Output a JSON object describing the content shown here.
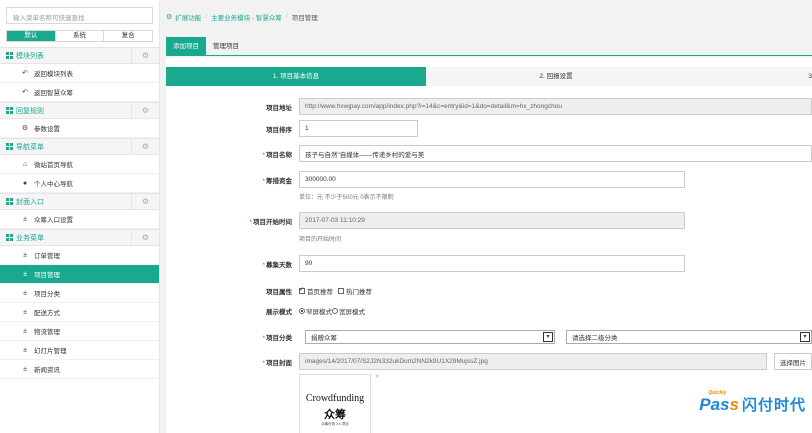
{
  "sidebar": {
    "search_placeholder": "输入菜单名称可快速查找",
    "tabs": [
      "默认",
      "系统",
      "复合"
    ],
    "sections": [
      {
        "title": "模块列表",
        "items": [
          {
            "icon": "reply-icon",
            "glyph": "↶",
            "label": "返回模块列表"
          },
          {
            "icon": "reply-icon",
            "glyph": "↶",
            "label": "返回智慧众筹"
          }
        ]
      },
      {
        "title": "回复规则",
        "items": [
          {
            "icon": "gear-icon",
            "glyph": "⚙",
            "label": "参数设置"
          }
        ]
      },
      {
        "title": "导航菜单",
        "items": [
          {
            "icon": "home-icon",
            "glyph": "⌂",
            "label": "微站首页导航"
          },
          {
            "icon": "user-icon",
            "glyph": "●",
            "label": "个人中心导航"
          }
        ]
      },
      {
        "title": "封面入口",
        "items": [
          {
            "icon": "pin-icon",
            "glyph": "±",
            "label": "众筹入口设置"
          }
        ]
      },
      {
        "title": "业务菜单",
        "items": [
          {
            "icon": "pin-icon",
            "glyph": "±",
            "label": "订单管理"
          },
          {
            "icon": "pin-icon",
            "glyph": "±",
            "label": "项目管理",
            "active": true
          },
          {
            "icon": "pin-icon",
            "glyph": "±",
            "label": "项目分类"
          },
          {
            "icon": "pin-icon",
            "glyph": "±",
            "label": "配送方式"
          },
          {
            "icon": "pin-icon",
            "glyph": "±",
            "label": "物流管理"
          },
          {
            "icon": "pin-icon",
            "glyph": "±",
            "label": "幻灯片管理"
          },
          {
            "icon": "pin-icon",
            "glyph": "±",
            "label": "新闻资讯"
          }
        ]
      }
    ]
  },
  "breadcrumb": {
    "items": [
      "扩展功能",
      "主要业务模块 - 智慧众筹"
    ],
    "current": "项目管理"
  },
  "tabs": [
    "添加项目",
    "管理项目"
  ],
  "steps": [
    "1. 项目基本信息",
    "2. 回报设置",
    "3"
  ],
  "form": {
    "url_label": "项目地址",
    "url_value": "http://www.hxwjpay.com/app/index.php?i=14&c=entry&id=1&do=detail&m=hx_zhongchou",
    "order_label": "项目排序",
    "order_value": "1",
    "name_label": "项目名称",
    "name_value": "孩子与自然\"自媒体——传递乡村的爱与美",
    "amount_label": "筹措资金",
    "amount_value": "300000.00",
    "amount_help": "单位：元 不少于500元 0表示不限制",
    "start_label": "项目开始时间",
    "start_value": "2017-07-03 11:10:29",
    "start_help": "项目的开始时间",
    "days_label": "募集天数",
    "days_value": "90",
    "attr_label": "项目属性",
    "attr_options": [
      "首页推荐",
      "热门推荐"
    ],
    "display_label": "展示模式",
    "display_options": [
      "窄屏模式",
      "宽屏模式"
    ],
    "category_label": "项目分类",
    "category_value": "捐赠众筹",
    "subcategory_value": "请选择二级分类",
    "cover_label": "项目封面",
    "cover_value": "images/14/2017/07/S2J2N332ukDum2NN2k9U1X29MujssZ.jpg",
    "cover_button": "选择图片",
    "thumb_en": "Crowdfunding",
    "thumb_cn": "众筹",
    "thumb_small": "众筹在线 XX 项目"
  },
  "watermark": {
    "pass": "Pas",
    "s": "s",
    "quick": "Quickly",
    "cn": "闪付时代"
  },
  "colors": {
    "accent": "#1aa98f",
    "required": "#e33333",
    "watermark_blue": "#1e88d8",
    "watermark_orange": "#f08a00"
  }
}
